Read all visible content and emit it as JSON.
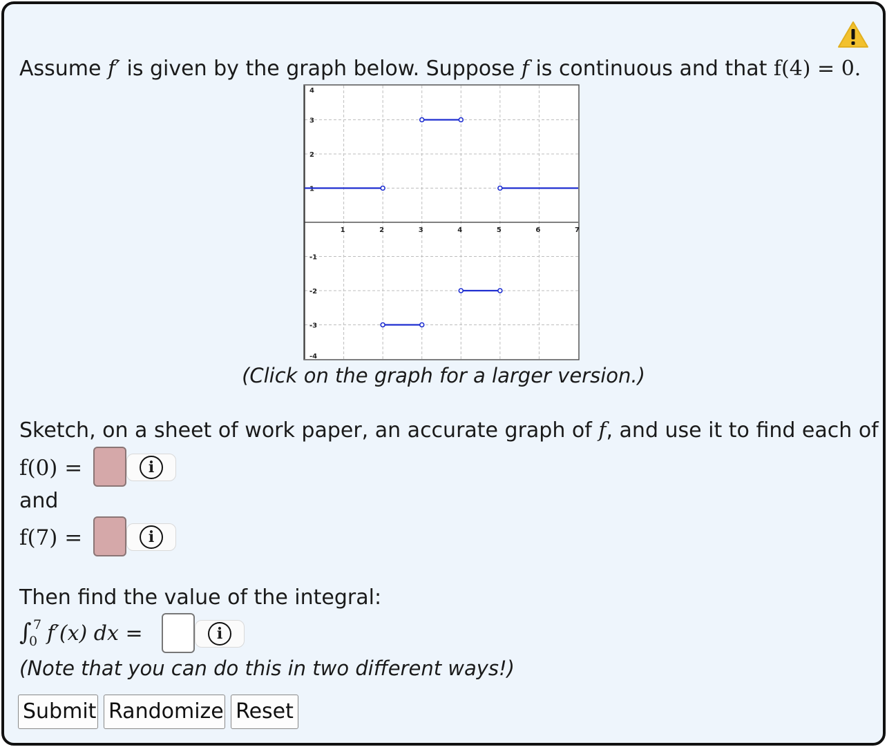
{
  "problem": {
    "intro_prefix": "Assume",
    "intro_fprime": "f′",
    "intro_mid": "is given by the graph below. Suppose",
    "intro_f": "f",
    "intro_mid2": "is continuous and that",
    "intro_cond": "f(4) = 0.",
    "graph_caption": "(Click on the graph for a larger version.)",
    "sketch_prefix": "Sketch, on a sheet of work paper, an accurate graph of",
    "sketch_f": "f",
    "sketch_suffix": ", and use it to find each of",
    "f0_label": "f(0) =",
    "and_label": "and",
    "f7_label": "f(7) =",
    "integral_prompt": "Then find the value of the integral:",
    "integral_sign": "∫",
    "integral_upper": "7",
    "integral_lower": "0",
    "integral_expr": "f′(x) dx =",
    "note": "(Note that you can do this in two different ways!)"
  },
  "answers": {
    "f0": "",
    "f7": "",
    "integral": ""
  },
  "icons": {
    "warning": "warning-icon",
    "info": "info-icon",
    "info_glyph": "i"
  },
  "buttons": {
    "submit": "Submit",
    "randomize": "Randomize",
    "reset": "Reset"
  },
  "colors": {
    "background": "#eef5fc",
    "incorrect_fill": "#d5a8a9",
    "graph_line": "#1f2fd0",
    "warning": "#f2c12e"
  },
  "chart_data": {
    "type": "line",
    "xlim": [
      0,
      7
    ],
    "ylim": [
      -4,
      4
    ],
    "grid": true,
    "x_ticks": [
      "1",
      "2",
      "3",
      "4",
      "5",
      "6",
      "7"
    ],
    "y_ticks": [
      "4",
      "3",
      "2",
      "1",
      "-1",
      "-2",
      "-3",
      "-4"
    ],
    "segments": [
      {
        "x": [
          0,
          2
        ],
        "y": 1,
        "open_start": false,
        "open_end": true
      },
      {
        "x": [
          2,
          3
        ],
        "y": -3,
        "open_start": true,
        "open_end": true
      },
      {
        "x": [
          3,
          4
        ],
        "y": 3,
        "open_start": true,
        "open_end": true
      },
      {
        "x": [
          4,
          5
        ],
        "y": -2,
        "open_start": true,
        "open_end": true
      },
      {
        "x": [
          5,
          7
        ],
        "y": 1,
        "open_start": true,
        "open_end": false
      }
    ]
  }
}
